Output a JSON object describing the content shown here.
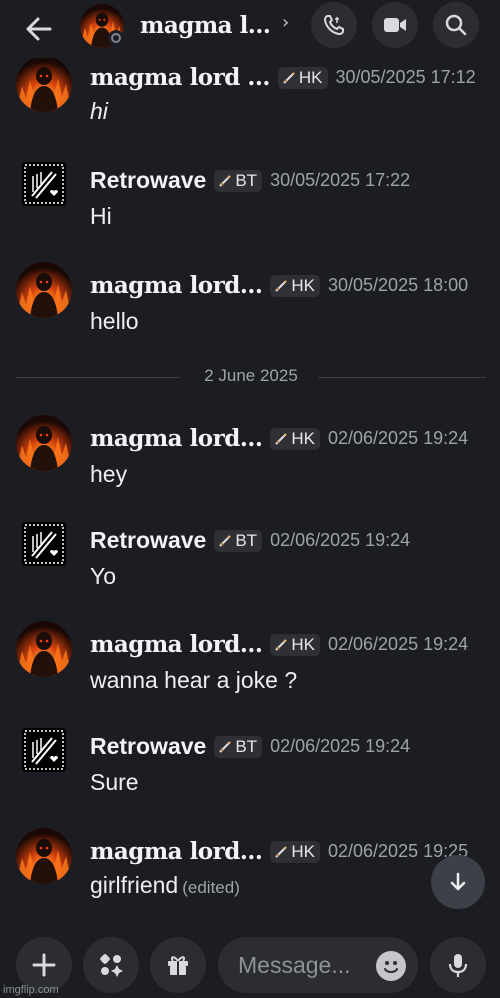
{
  "header": {
    "title": "magma l...",
    "icons": [
      "arrow-left-icon",
      "chevron-right-icon",
      "phone-icon",
      "video-camera-icon",
      "search-icon"
    ]
  },
  "messages": [
    {
      "author": "magma lord ...",
      "tag": "HK",
      "time": "30/05/2025 17:12",
      "text": "hi",
      "italic": true
    },
    {
      "author": "Retrowave",
      "tag": "BT",
      "time": "30/05/2025 17:22",
      "text": "Hi"
    },
    {
      "author": "magma lord...",
      "tag": "HK",
      "time": "30/05/2025 18:00",
      "text": "hello"
    },
    {
      "author": "magma lord...",
      "tag": "HK",
      "time": "02/06/2025 19:24",
      "text": "hey"
    },
    {
      "author": "Retrowave",
      "tag": "BT",
      "time": "02/06/2025 19:24",
      "text": "Yo"
    },
    {
      "author": "magma lord...",
      "tag": "HK",
      "time": "02/06/2025 19:24",
      "text": "wanna hear a joke ?"
    },
    {
      "author": "Retrowave",
      "tag": "BT",
      "time": "02/06/2025 19:24",
      "text": "Sure"
    },
    {
      "author": "magma lord...",
      "tag": "HK",
      "time": "02/06/2025 19:25",
      "text": "girlfriend",
      "edited": "(edited)"
    }
  ],
  "date_divider": "2 June 2025",
  "composer": {
    "placeholder": "Message...",
    "icons": [
      "plus-icon",
      "apps-icon",
      "gift-icon",
      "emoji-icon",
      "microphone-icon",
      "arrow-down-icon"
    ]
  },
  "watermark": "imgflip.com",
  "colors": {
    "background": "#1c1d22",
    "button": "#2b2d31",
    "muted": "#9ea2a9"
  }
}
